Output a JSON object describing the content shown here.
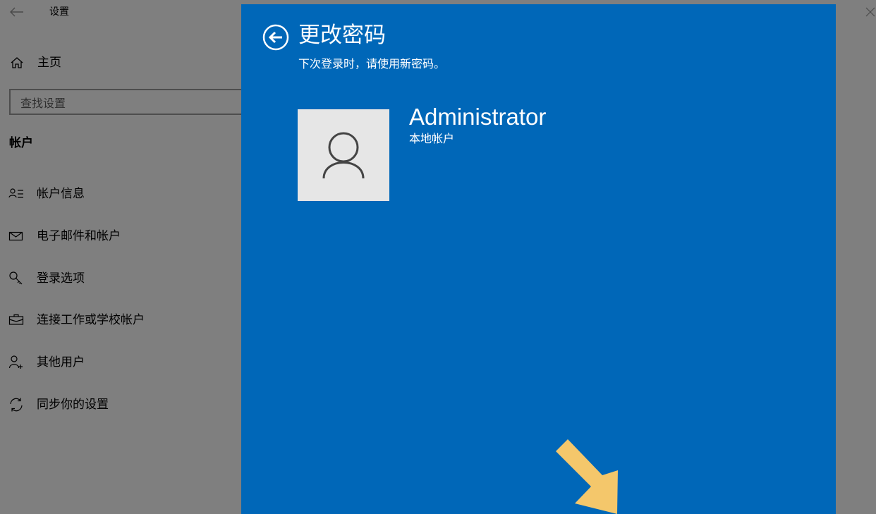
{
  "window": {
    "title": "设置"
  },
  "sidebar": {
    "home_label": "主页",
    "search_placeholder": "查找设置",
    "section_title": "帐户",
    "items": [
      {
        "label": "帐户信息",
        "icon": "account-info-icon"
      },
      {
        "label": "电子邮件和帐户",
        "icon": "mail-icon"
      },
      {
        "label": "登录选项",
        "icon": "key-icon"
      },
      {
        "label": "连接工作或学校帐户",
        "icon": "briefcase-icon"
      },
      {
        "label": "其他用户",
        "icon": "person-add-icon"
      },
      {
        "label": "同步你的设置",
        "icon": "sync-icon"
      }
    ]
  },
  "dialog": {
    "title": "更改密码",
    "subtitle": "下次登录时，请使用新密码。",
    "user_name": "Administrator",
    "user_type": "本地帐户",
    "background_color": "#0067b8",
    "arrow_color": "#f4c76b"
  }
}
